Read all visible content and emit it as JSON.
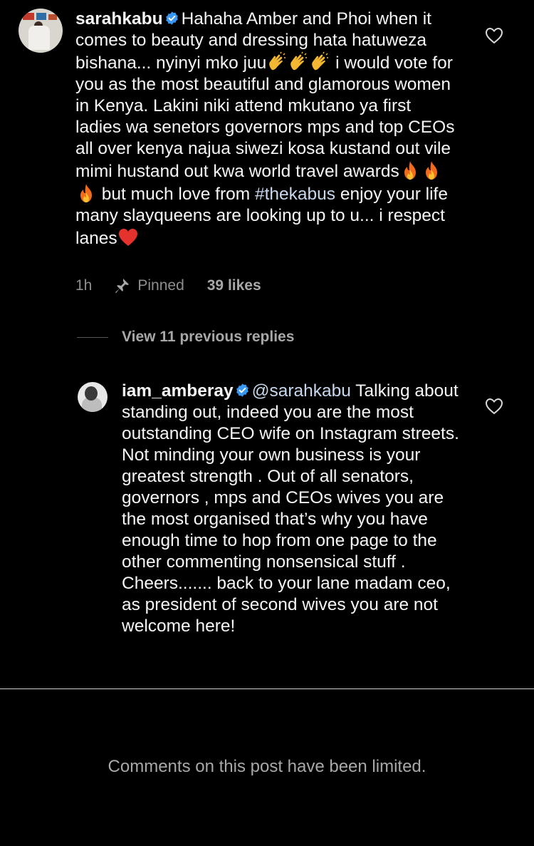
{
  "comments": [
    {
      "username": "sarahkabu",
      "verified": true,
      "text_part1": "Hahaha Amber and Phoi when it comes to beauty and dressing hata hatuweza bishana... nyinyi mko juu",
      "text_part2": " i would vote for you as the most beautiful and glamorous women in Kenya. Lakini niki attend mkutano ya first ladies wa senetors governors mps and top CEOs all over kenya najua siwezi kosa kustand  out vile mimi hustand out kwa world travel awards",
      "text_part3": " but much love from ",
      "hashtag": "#thekabus",
      "text_part4": " enjoy your life many slayqueens are looking up to u... i respect lanes",
      "time": "1h",
      "pinned_label": "Pinned",
      "likes": "39 likes"
    },
    {
      "username": "iam_amberay",
      "verified": true,
      "mention": "@sarahkabu",
      "text": " Talking about standing out, indeed you are the most outstanding CEO wife on Instagram streets. Not minding your own business is your greatest strength . Out of all senators, governors , mps and CEOs wives you are the most organised that’s why you have enough time to hop from one page to the other commenting nonsensical stuff . Cheers....... back to your lane madam ceo, as president of second wives you are not welcome here!"
    }
  ],
  "view_replies_label": "View 11 previous replies",
  "limited_notice": "Comments on this post have been limited.",
  "icons": {
    "like": "heart-outline-icon",
    "pin": "pin-icon",
    "verified": "verified-badge-icon",
    "emoji_clap": "clapping-hands-icon",
    "emoji_fire": "fire-icon",
    "emoji_heart": "red-heart-icon"
  },
  "colors": {
    "background": "#000000",
    "text": "#f5f5f5",
    "muted": "#8e8e8e",
    "verified": "#3897f0",
    "hashtag": "#c7d7ee"
  }
}
